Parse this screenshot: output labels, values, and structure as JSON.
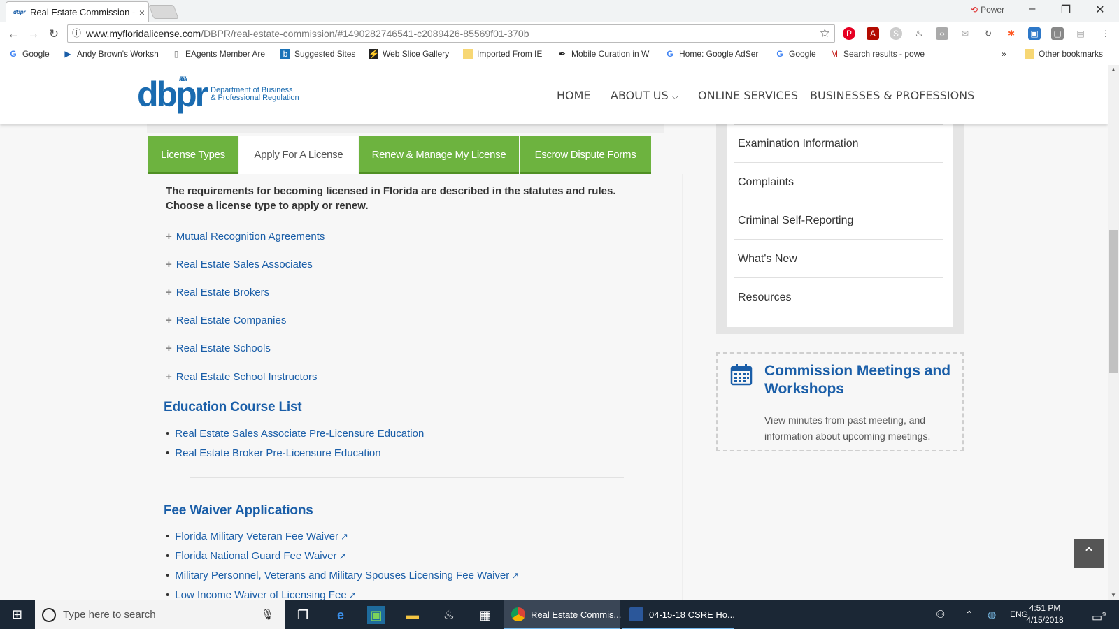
{
  "browser": {
    "tab_title": "Real Estate Commission -",
    "tab_favicon_text": "dbpr",
    "tab_close": "×",
    "power_label": "Power",
    "url_host": "www.myfloridalicense.com",
    "url_path": "/DBPR/real-estate-commission/#1490282746541-c2089426-85569f01-370b",
    "bookmarks": [
      "Google",
      "Andy Brown's Worksh",
      "EAgents Member Are",
      "Suggested Sites",
      "Web Slice Gallery",
      "Imported From IE",
      "Mobile Curation in W",
      "Home: Google AdSer",
      "Google",
      "Search results - powe"
    ],
    "bookmarks_overflow": "»",
    "other_bookmarks": "Other bookmarks"
  },
  "site": {
    "logo_text": "dbpr",
    "logo_state": "Florida",
    "logo_dept_line1": "Department of Business",
    "logo_dept_line2": "& Professional Regulation",
    "nav": [
      "HOME",
      "ABOUT US",
      "ONLINE SERVICES",
      "BUSINESSES & PROFESSIONS"
    ],
    "about_caret": "⌄"
  },
  "tabs": [
    "License Types",
    "Apply For A License",
    "Renew & Manage My License",
    "Escrow Dispute Forms"
  ],
  "content": {
    "intro": "The requirements for becoming licensed in Florida are described in the statutes and rules.  Choose a license type to apply or renew.",
    "accordion": [
      "Mutual Recognition Agreements",
      "Real Estate Sales Associates",
      "Real Estate Brokers",
      "Real Estate Companies",
      "Real Estate Schools",
      "Real Estate School Instructors"
    ],
    "education_heading": "Education Course List",
    "education_links": [
      "Real Estate Sales Associate Pre-Licensure Education",
      "Real Estate Broker Pre-Licensure Education"
    ],
    "fee_heading": "Fee Waiver Applications",
    "fee_links": [
      "Florida Military Veteran Fee Waiver",
      "Florida National Guard Fee Waiver",
      "Military Personnel, Veterans and Military Spouses Licensing Fee Waiver",
      "Low Income Waiver of Licensing Fee"
    ]
  },
  "sidebar": {
    "items": [
      "Examination Information",
      "Complaints",
      "Criminal Self-Reporting",
      "What's New",
      "Resources"
    ],
    "meetings_title": "Commission Meetings and Workshops",
    "meetings_desc": "View minutes from past meeting, and information about upcoming meetings."
  },
  "taskbar": {
    "search_placeholder": "Type here to search",
    "apps": [
      "Real Estate Commis...",
      "04-15-18 CSRE Ho..."
    ],
    "lang": "ENG",
    "time": "4:51 PM",
    "date": "4/15/2018",
    "notifications": "9"
  },
  "colors": {
    "green_tab": "#6db33f",
    "link_blue": "#1a5ea8",
    "taskbar": "#1b2735"
  }
}
